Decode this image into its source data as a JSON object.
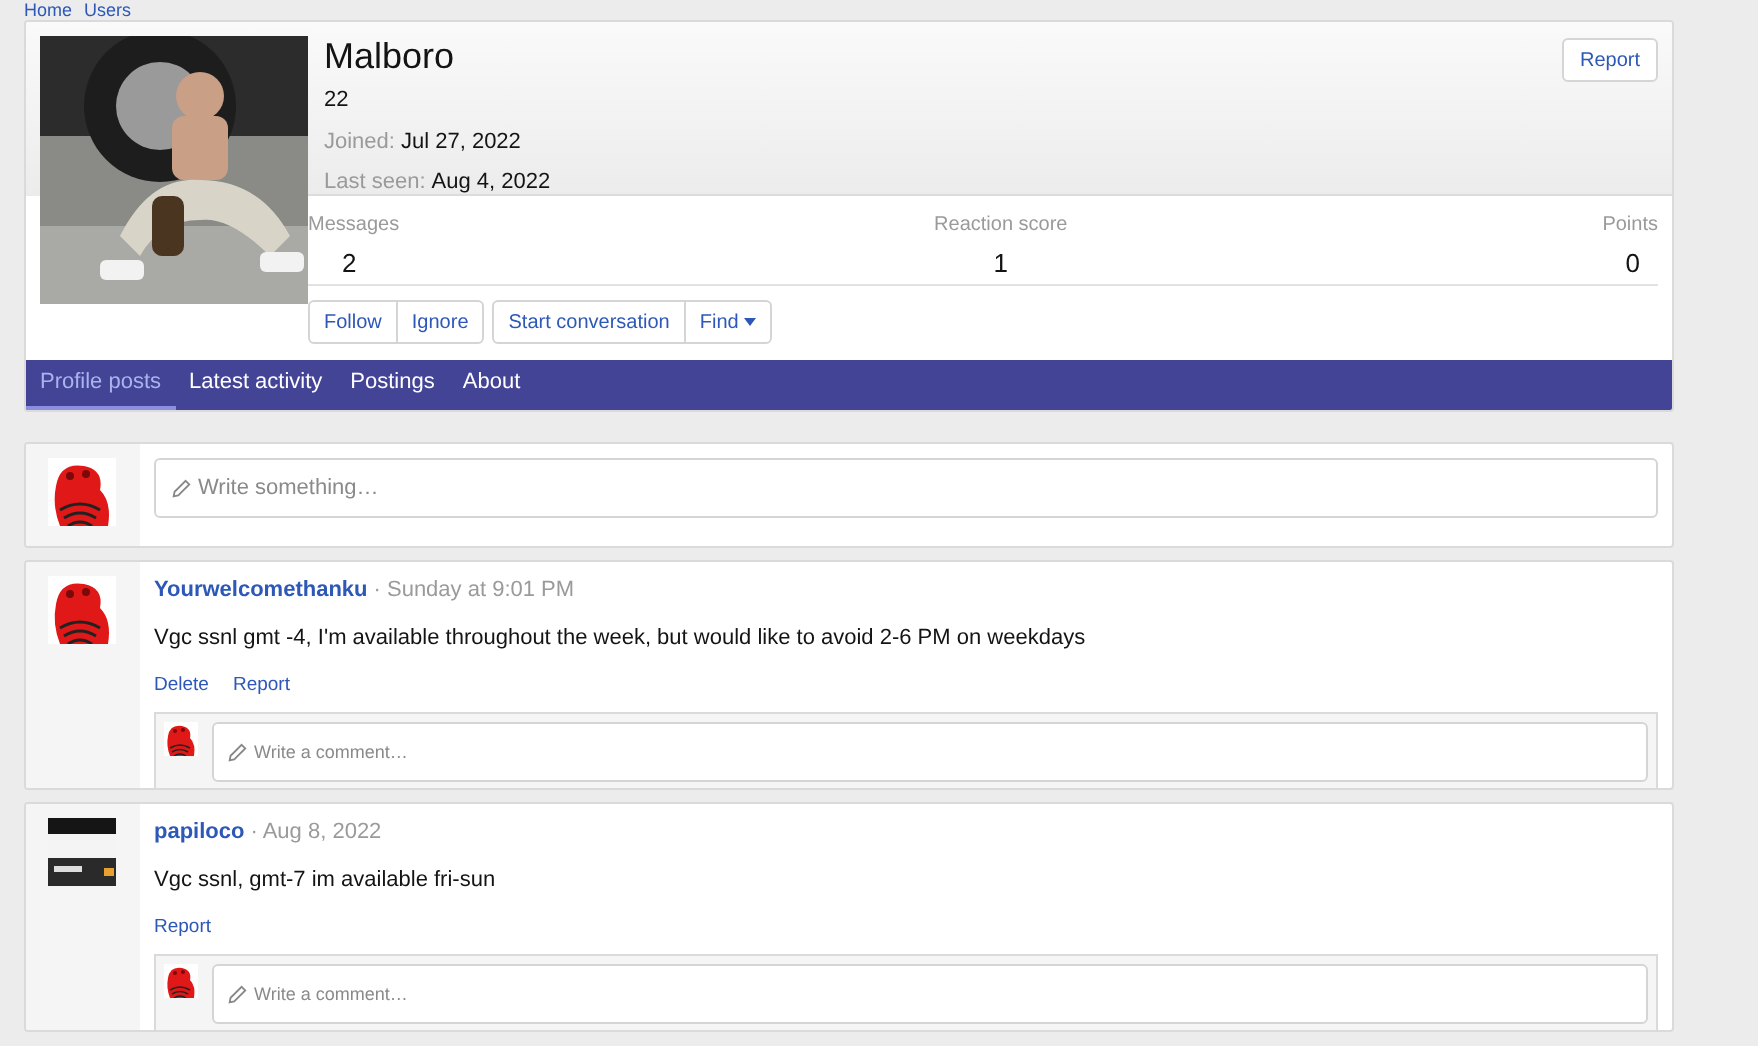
{
  "breadcrumb": [
    "Home",
    "Users"
  ],
  "profile": {
    "name": "Malboro",
    "subtitle": "22",
    "joined_label": "Joined:",
    "joined": "Jul 27, 2022",
    "last_seen_label": "Last seen:",
    "last_seen": "Aug 4, 2022",
    "report": "Report",
    "stats": [
      {
        "label": "Messages",
        "value": "2"
      },
      {
        "label": "Reaction score",
        "value": "1"
      },
      {
        "label": "Points",
        "value": "0"
      }
    ],
    "button_groups": [
      [
        "Follow",
        "Ignore"
      ],
      [
        "Start conversation",
        "Find"
      ]
    ]
  },
  "tabs": [
    {
      "label": "Profile posts",
      "selected": true
    },
    {
      "label": "Latest activity",
      "selected": false
    },
    {
      "label": "Postings",
      "selected": false
    },
    {
      "label": "About",
      "selected": false
    }
  ],
  "composer": {
    "placeholder": "Write something…"
  },
  "posts": [
    {
      "author": "Yourwelcomethanku",
      "time": "· Sunday at 9:01 PM",
      "text": "Vgc ssnl gmt -4, I'm available throughout the week, but would like to avoid 2-6 PM on weekdays",
      "actions": [
        "Delete",
        "Report"
      ],
      "comment_placeholder": "Write a comment…"
    },
    {
      "author": "papiloco",
      "time": "· Aug 8, 2022",
      "text": "Vgc ssnl, gmt-7 im available fri-sun",
      "actions": [
        "Report"
      ],
      "comment_placeholder": "Write a comment…"
    }
  ]
}
